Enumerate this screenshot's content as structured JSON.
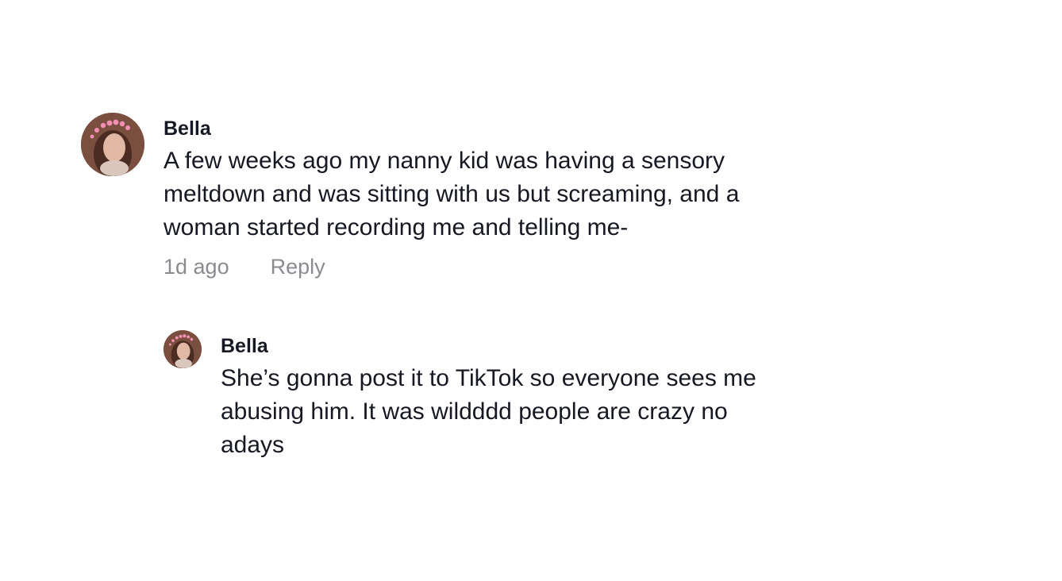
{
  "comment": {
    "username": "Bella",
    "text": "A few weeks ago my nanny kid was having a sensory meltdown and was sitting with us but screaming, and a woman started recording me and telling me-",
    "time": "1d ago",
    "reply_label": "Reply"
  },
  "reply": {
    "username": "Bella",
    "text": "She’s gonna post it to TikTok so everyone sees me abusing him. It was wildddd people are crazy no adays"
  },
  "colors": {
    "text": "#161823",
    "meta": "#8a8b91",
    "background": "#ffffff"
  }
}
